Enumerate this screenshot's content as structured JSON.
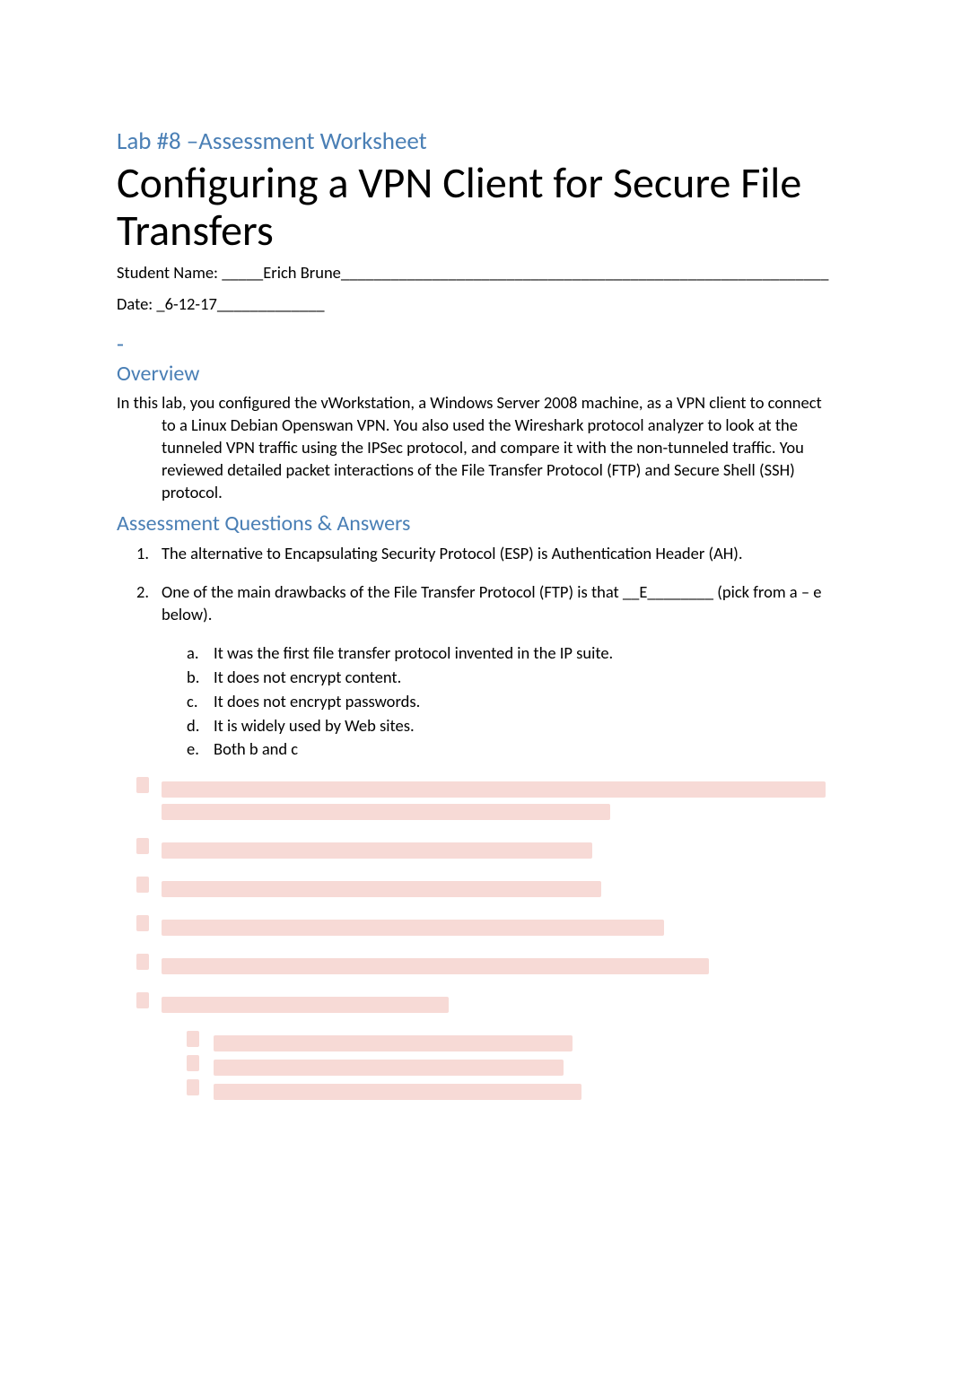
{
  "subtitle": "Lab #8 –Assessment Worksheet",
  "title": "Configuring a VPN Client for Secure File Transfers",
  "student_line": "Student Name: _____Erich Brune___________________________________________________________",
  "date_line": "Date: _6-12-17_____________",
  "dash": "-",
  "overview_heading": "Overview",
  "overview_text": "In this lab, you configured the vWorkstation, a Windows Server 2008 machine, as a VPN client to connect to a Linux Debian Openswan VPN.  You also used the Wireshark protocol analyzer to look at the tunneled VPN traffic using the IPSec protocol, and compare it with the non-tunneled traffic.  You reviewed detailed packet interactions of the File Transfer Protocol (FTP) and Secure Shell (SSH) protocol.",
  "assessment_heading": "Assessment Questions & Answers",
  "questions": [
    {
      "num": "1.",
      "text": "The alternative to Encapsulating Security Protocol (ESP) is Authentication Header (AH)."
    },
    {
      "num": "2.",
      "text": "One of the main drawbacks of the File Transfer Protocol (FTP) is that __E________ (pick from a – e below).",
      "options": [
        {
          "letter": "a.",
          "text": "It was the first file transfer protocol invented in the IP suite."
        },
        {
          "letter": "b.",
          "text": "It does not encrypt content."
        },
        {
          "letter": "c.",
          "text": "It does not encrypt passwords."
        },
        {
          "letter": "d.",
          "text": "It is widely used by Web sites."
        },
        {
          "letter": "e.",
          "text": "Both b and c"
        }
      ]
    }
  ],
  "hidden_items": [
    {
      "lines": [
        740,
        500
      ]
    },
    {
      "lines": [
        480
      ]
    },
    {
      "lines": [
        490
      ]
    },
    {
      "lines": [
        560
      ]
    },
    {
      "lines": [
        610
      ]
    },
    {
      "lines": [
        320
      ],
      "subs": [
        400,
        390,
        410
      ]
    }
  ]
}
